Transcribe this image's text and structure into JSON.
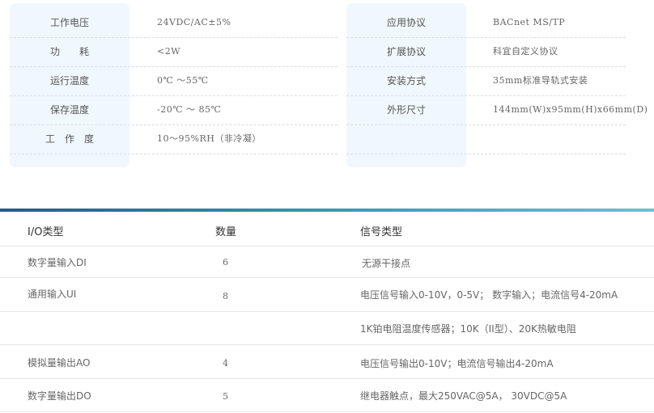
{
  "specs": {
    "left": [
      {
        "label": "工作电压",
        "value": "24VDC/AC±5%"
      },
      {
        "label": "功　　耗",
        "value": "<2W"
      },
      {
        "label": "运行温度",
        "value": "0℃ ～55℃"
      },
      {
        "label": "保存温度",
        "value": "-20℃ ～ 85℃"
      },
      {
        "label": "工　作　度",
        "value": "10～95%RH（非冷凝）"
      }
    ],
    "right": [
      {
        "label": "应用协议",
        "value": "BACnet MS/TP"
      },
      {
        "label": "扩展协议",
        "value": "科宜自定义协议"
      },
      {
        "label": "安装方式",
        "value": "35mm标准导轨式安装"
      },
      {
        "label": "外形尺寸",
        "value": "144mm(W)x95mm(H)x66mm(D)"
      },
      {
        "label": "",
        "value": ""
      }
    ]
  },
  "io_table": {
    "headers": {
      "type": "I/O类型",
      "count": "数量",
      "signal": "信号类型"
    },
    "rows": [
      {
        "type": "数字量输入DI",
        "count": "6",
        "signal": "无源干接点"
      },
      {
        "type": "通用输入UI",
        "count": "8",
        "signal": "电压信号输入0-10V，0-5V；  数字输入；电流信号4-20mA"
      },
      {
        "type": "",
        "count": "",
        "signal": "1K铂电阻温度传感器；10K（II型）、20K热敏电阻"
      },
      {
        "type": "模拟量输出AO",
        "count": "4",
        "signal": "电压信号输出0-10V；电流信号输出4-20mA"
      },
      {
        "type": "数字量输出DO",
        "count": "5",
        "signal": "继电器触点，最大250VAC@5A，  30VDC@5A"
      }
    ]
  },
  "colors": {
    "label_bg": "#f1f8fd",
    "bar_start": "#1f5f86",
    "bar_end": "#6cc1d2"
  }
}
